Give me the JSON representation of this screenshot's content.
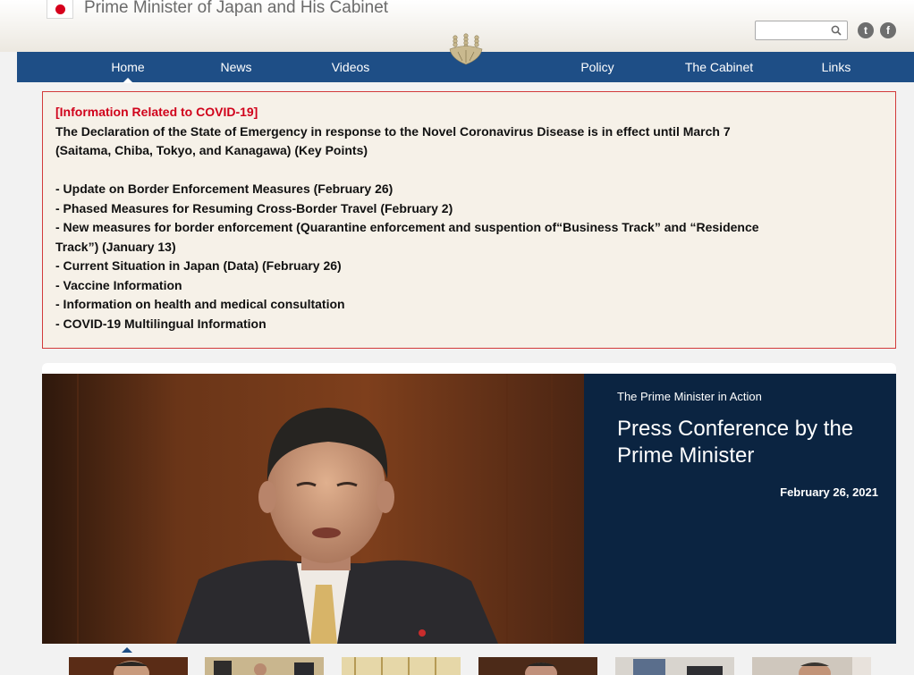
{
  "header": {
    "site_title": "Prime Minister of Japan and His Cabinet",
    "search": {
      "placeholder": "",
      "value": ""
    },
    "social": [
      {
        "name": "twitter",
        "glyph": "t"
      },
      {
        "name": "facebook",
        "glyph": "f"
      }
    ]
  },
  "nav": {
    "items": [
      {
        "label": "Home",
        "active": true
      },
      {
        "label": "News"
      },
      {
        "label": "Videos"
      },
      {
        "label": "Policy"
      },
      {
        "label": "The Cabinet"
      },
      {
        "label": "Links"
      }
    ]
  },
  "covid": {
    "heading": "[Information Related to COVID-19]",
    "intro_1": "The Declaration of the State of Emergency in response to the Novel Coronavirus Disease is in effect until March 7",
    "intro_2": "(Saitama, Chiba, Tokyo, and Kanagawa) (Key Points)",
    "links": [
      "- Update on Border Enforcement Measures (February 26)",
      "- Phased Measures for Resuming Cross-Border Travel (February 2)",
      "- New measures for border enforcement (Quarantine enforcement and suspention of“Business Track” and “Residence",
      "Track”) (January 13)",
      "- Current Situation in Japan (Data) (February 26)",
      "- Vaccine Information",
      "- Information on health and medical consultation",
      "- COVID-19 Multilingual Information"
    ]
  },
  "hero": {
    "kicker": "The Prime Minister in Action",
    "title_1": "Press Conference by the",
    "title_2": "Prime Minister",
    "date": "February 26, 2021"
  },
  "colors": {
    "nav_bg": "#1e4e86",
    "alert_border": "#d23a3a",
    "alert_heading": "#d0021b",
    "hero_panel": "#0b2441"
  }
}
